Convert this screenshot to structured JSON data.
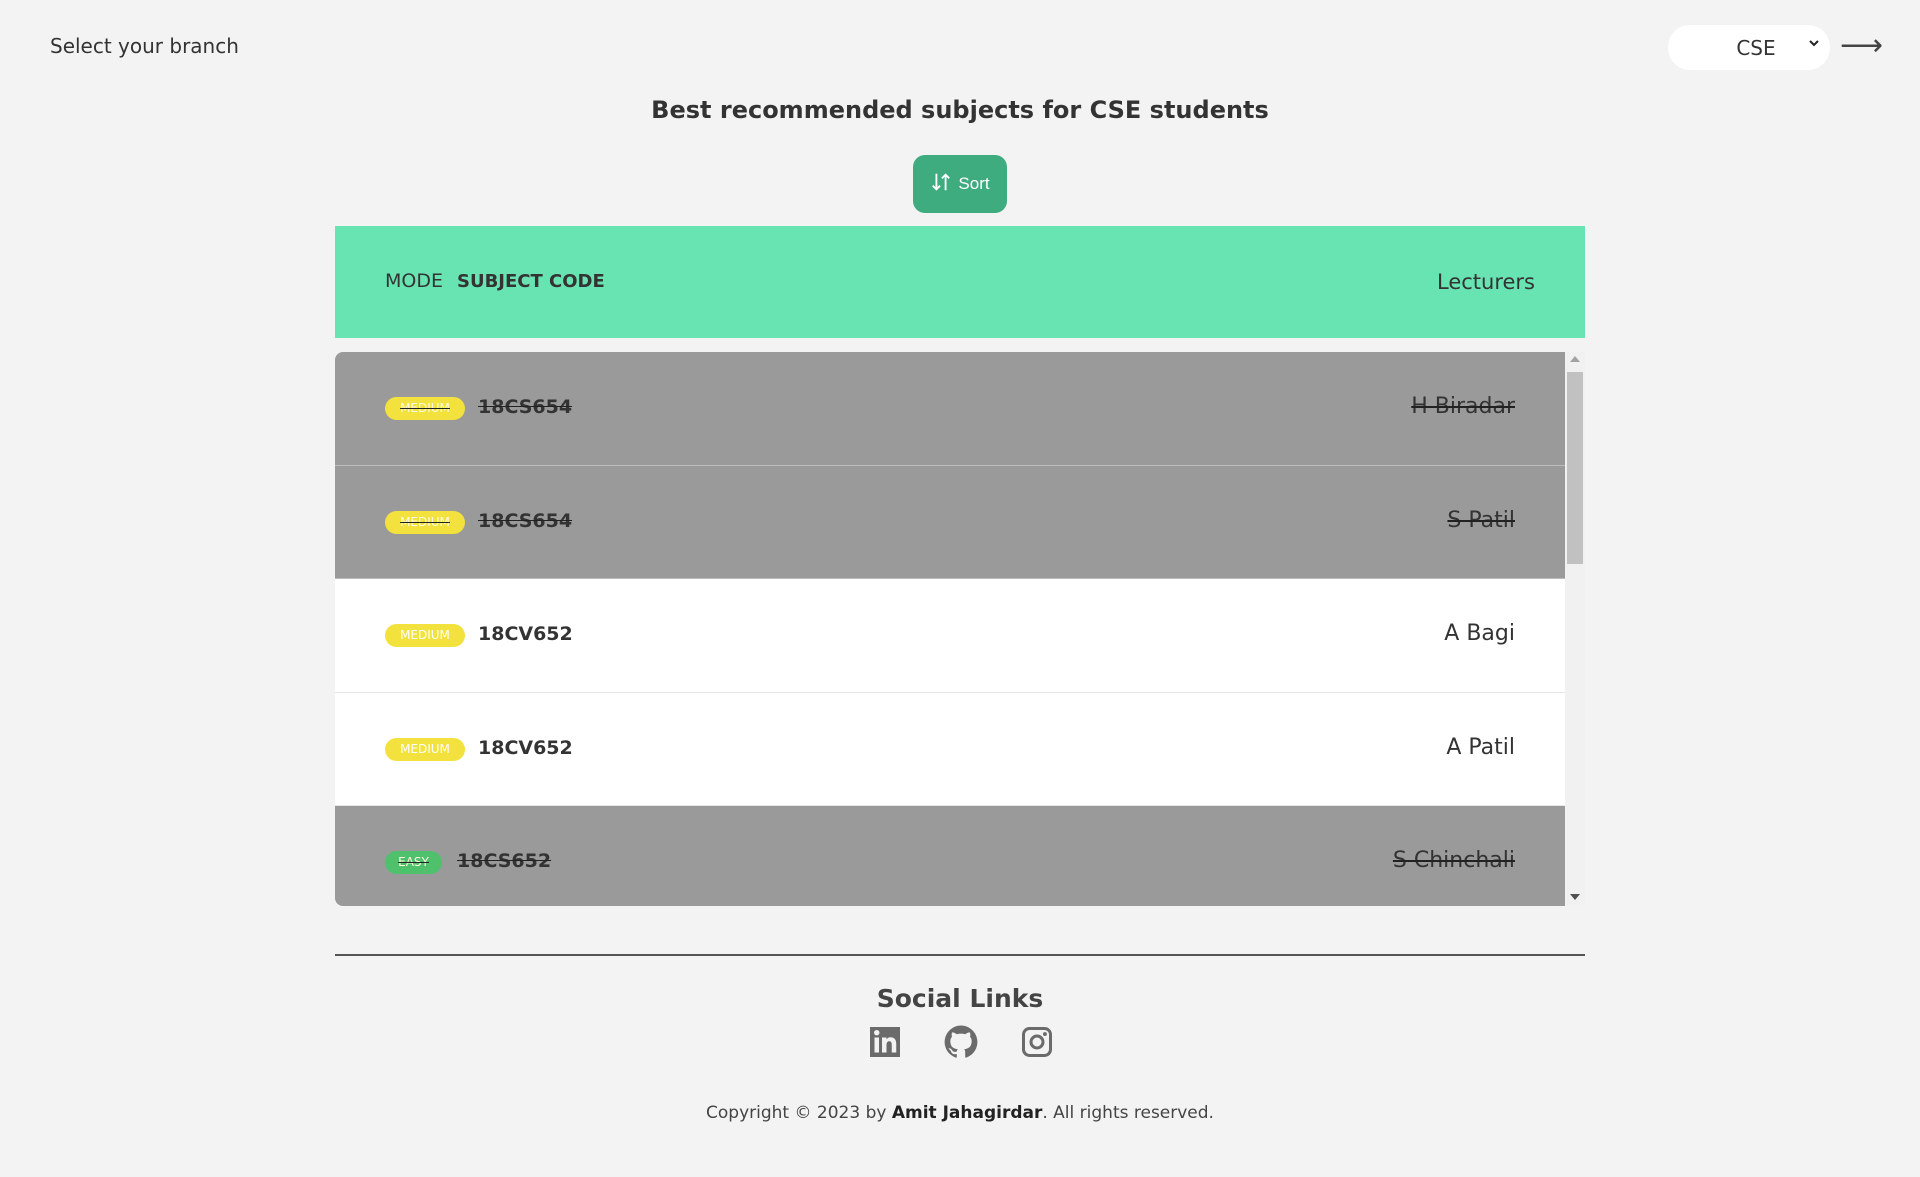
{
  "header": {
    "branch_label": "Select your branch",
    "branch_selected": "CSE",
    "arrow_glyph": "⟶"
  },
  "main": {
    "title": "Best recommended subjects for CSE students",
    "sort_label": "Sort"
  },
  "table": {
    "columns": {
      "mode": "MODE",
      "subject_code": "SUBJECT CODE",
      "lecturers": "Lecturers"
    },
    "rows": [
      {
        "mode": "MEDIUM",
        "code": "18CS654",
        "lecturer": "H Biradar",
        "struck": true
      },
      {
        "mode": "MEDIUM",
        "code": "18CS654",
        "lecturer": "S Patil",
        "struck": true
      },
      {
        "mode": "MEDIUM",
        "code": "18CV652",
        "lecturer": "A Bagi",
        "struck": false
      },
      {
        "mode": "MEDIUM",
        "code": "18CV652",
        "lecturer": "A Patil",
        "struck": false
      },
      {
        "mode": "EASY",
        "code": "18CS652",
        "lecturer": "S Chinchali",
        "struck": true
      }
    ]
  },
  "footer": {
    "social_title": "Social Links",
    "icons": [
      "linkedin-icon",
      "github-icon",
      "instagram-icon"
    ],
    "copyright_prefix": "Copyright © 2023 by",
    "copyright_author": "Amit Jahagirdar",
    "copyright_suffix": ". All rights reserved."
  },
  "colors": {
    "accent_green": "#3eac7f",
    "header_mint": "#68e4b3",
    "medium_badge": "#f3e23e",
    "easy_badge": "#4fc16c",
    "struck_row": "#9a9a9a"
  }
}
